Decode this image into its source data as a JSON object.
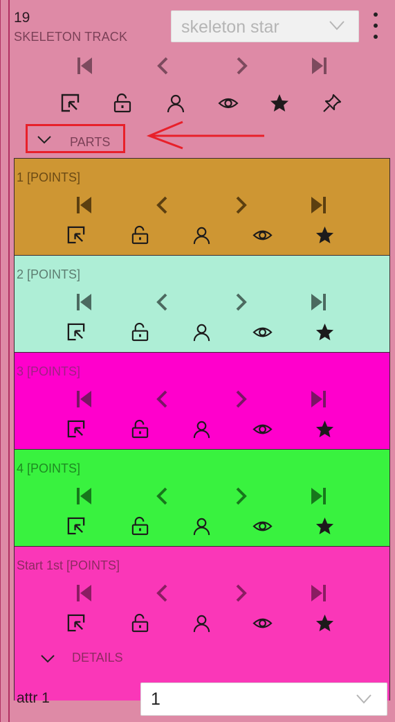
{
  "track": {
    "id": "19",
    "label": "SKELETON TRACK",
    "label_select_value": "skeleton star",
    "parts_toggle_label": "PARTS"
  },
  "parts": [
    {
      "title": "1 [POINTS]",
      "color": "#ce9633",
      "fg": "#5c3f10",
      "title_color": "#6b4a15"
    },
    {
      "title": "2 [POINTS]",
      "color": "#aeeed6",
      "fg": "#4c6a60",
      "title_color": "#5d7d71"
    },
    {
      "title": "3 [POINTS]",
      "color": "#ff00cc",
      "fg": "#7a1565",
      "title_color": "#a02085"
    },
    {
      "title": "4 [POINTS]",
      "color": "#39f23f",
      "fg": "#17771c",
      "title_color": "#1e8a22"
    },
    {
      "title": "Start 1st [POINTS]",
      "color": "#fa37b8",
      "fg": "#8a1d62",
      "title_color": "#8e2a62"
    }
  ],
  "details": {
    "toggle_label": "DETAILS",
    "attr_label": "attr 1",
    "attr_value": "1"
  },
  "icons": {
    "nav": [
      "first-frame-icon",
      "previous-frame-icon",
      "next-frame-icon",
      "last-frame-icon"
    ],
    "actions": [
      "change-color-icon",
      "lock-icon",
      "occluded-icon",
      "visibility-eye-icon",
      "star-icon",
      "pin-icon"
    ]
  },
  "colors": {
    "panel": "#de8aa6",
    "annotation_red": "#e8202a"
  }
}
